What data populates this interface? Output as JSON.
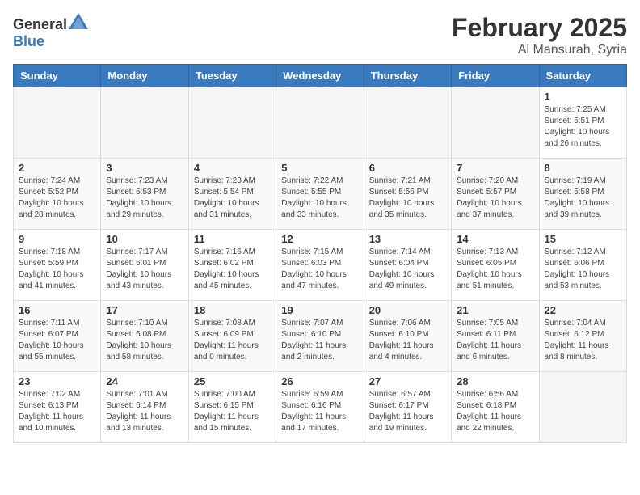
{
  "header": {
    "logo_general": "General",
    "logo_blue": "Blue",
    "month": "February 2025",
    "location": "Al Mansurah, Syria"
  },
  "days_of_week": [
    "Sunday",
    "Monday",
    "Tuesday",
    "Wednesday",
    "Thursday",
    "Friday",
    "Saturday"
  ],
  "weeks": [
    [
      {
        "day": "",
        "info": ""
      },
      {
        "day": "",
        "info": ""
      },
      {
        "day": "",
        "info": ""
      },
      {
        "day": "",
        "info": ""
      },
      {
        "day": "",
        "info": ""
      },
      {
        "day": "",
        "info": ""
      },
      {
        "day": "1",
        "info": "Sunrise: 7:25 AM\nSunset: 5:51 PM\nDaylight: 10 hours and 26 minutes."
      }
    ],
    [
      {
        "day": "2",
        "info": "Sunrise: 7:24 AM\nSunset: 5:52 PM\nDaylight: 10 hours and 28 minutes."
      },
      {
        "day": "3",
        "info": "Sunrise: 7:23 AM\nSunset: 5:53 PM\nDaylight: 10 hours and 29 minutes."
      },
      {
        "day": "4",
        "info": "Sunrise: 7:23 AM\nSunset: 5:54 PM\nDaylight: 10 hours and 31 minutes."
      },
      {
        "day": "5",
        "info": "Sunrise: 7:22 AM\nSunset: 5:55 PM\nDaylight: 10 hours and 33 minutes."
      },
      {
        "day": "6",
        "info": "Sunrise: 7:21 AM\nSunset: 5:56 PM\nDaylight: 10 hours and 35 minutes."
      },
      {
        "day": "7",
        "info": "Sunrise: 7:20 AM\nSunset: 5:57 PM\nDaylight: 10 hours and 37 minutes."
      },
      {
        "day": "8",
        "info": "Sunrise: 7:19 AM\nSunset: 5:58 PM\nDaylight: 10 hours and 39 minutes."
      }
    ],
    [
      {
        "day": "9",
        "info": "Sunrise: 7:18 AM\nSunset: 5:59 PM\nDaylight: 10 hours and 41 minutes."
      },
      {
        "day": "10",
        "info": "Sunrise: 7:17 AM\nSunset: 6:01 PM\nDaylight: 10 hours and 43 minutes."
      },
      {
        "day": "11",
        "info": "Sunrise: 7:16 AM\nSunset: 6:02 PM\nDaylight: 10 hours and 45 minutes."
      },
      {
        "day": "12",
        "info": "Sunrise: 7:15 AM\nSunset: 6:03 PM\nDaylight: 10 hours and 47 minutes."
      },
      {
        "day": "13",
        "info": "Sunrise: 7:14 AM\nSunset: 6:04 PM\nDaylight: 10 hours and 49 minutes."
      },
      {
        "day": "14",
        "info": "Sunrise: 7:13 AM\nSunset: 6:05 PM\nDaylight: 10 hours and 51 minutes."
      },
      {
        "day": "15",
        "info": "Sunrise: 7:12 AM\nSunset: 6:06 PM\nDaylight: 10 hours and 53 minutes."
      }
    ],
    [
      {
        "day": "16",
        "info": "Sunrise: 7:11 AM\nSunset: 6:07 PM\nDaylight: 10 hours and 55 minutes."
      },
      {
        "day": "17",
        "info": "Sunrise: 7:10 AM\nSunset: 6:08 PM\nDaylight: 10 hours and 58 minutes."
      },
      {
        "day": "18",
        "info": "Sunrise: 7:08 AM\nSunset: 6:09 PM\nDaylight: 11 hours and 0 minutes."
      },
      {
        "day": "19",
        "info": "Sunrise: 7:07 AM\nSunset: 6:10 PM\nDaylight: 11 hours and 2 minutes."
      },
      {
        "day": "20",
        "info": "Sunrise: 7:06 AM\nSunset: 6:10 PM\nDaylight: 11 hours and 4 minutes."
      },
      {
        "day": "21",
        "info": "Sunrise: 7:05 AM\nSunset: 6:11 PM\nDaylight: 11 hours and 6 minutes."
      },
      {
        "day": "22",
        "info": "Sunrise: 7:04 AM\nSunset: 6:12 PM\nDaylight: 11 hours and 8 minutes."
      }
    ],
    [
      {
        "day": "23",
        "info": "Sunrise: 7:02 AM\nSunset: 6:13 PM\nDaylight: 11 hours and 10 minutes."
      },
      {
        "day": "24",
        "info": "Sunrise: 7:01 AM\nSunset: 6:14 PM\nDaylight: 11 hours and 13 minutes."
      },
      {
        "day": "25",
        "info": "Sunrise: 7:00 AM\nSunset: 6:15 PM\nDaylight: 11 hours and 15 minutes."
      },
      {
        "day": "26",
        "info": "Sunrise: 6:59 AM\nSunset: 6:16 PM\nDaylight: 11 hours and 17 minutes."
      },
      {
        "day": "27",
        "info": "Sunrise: 6:57 AM\nSunset: 6:17 PM\nDaylight: 11 hours and 19 minutes."
      },
      {
        "day": "28",
        "info": "Sunrise: 6:56 AM\nSunset: 6:18 PM\nDaylight: 11 hours and 22 minutes."
      },
      {
        "day": "",
        "info": ""
      }
    ]
  ]
}
